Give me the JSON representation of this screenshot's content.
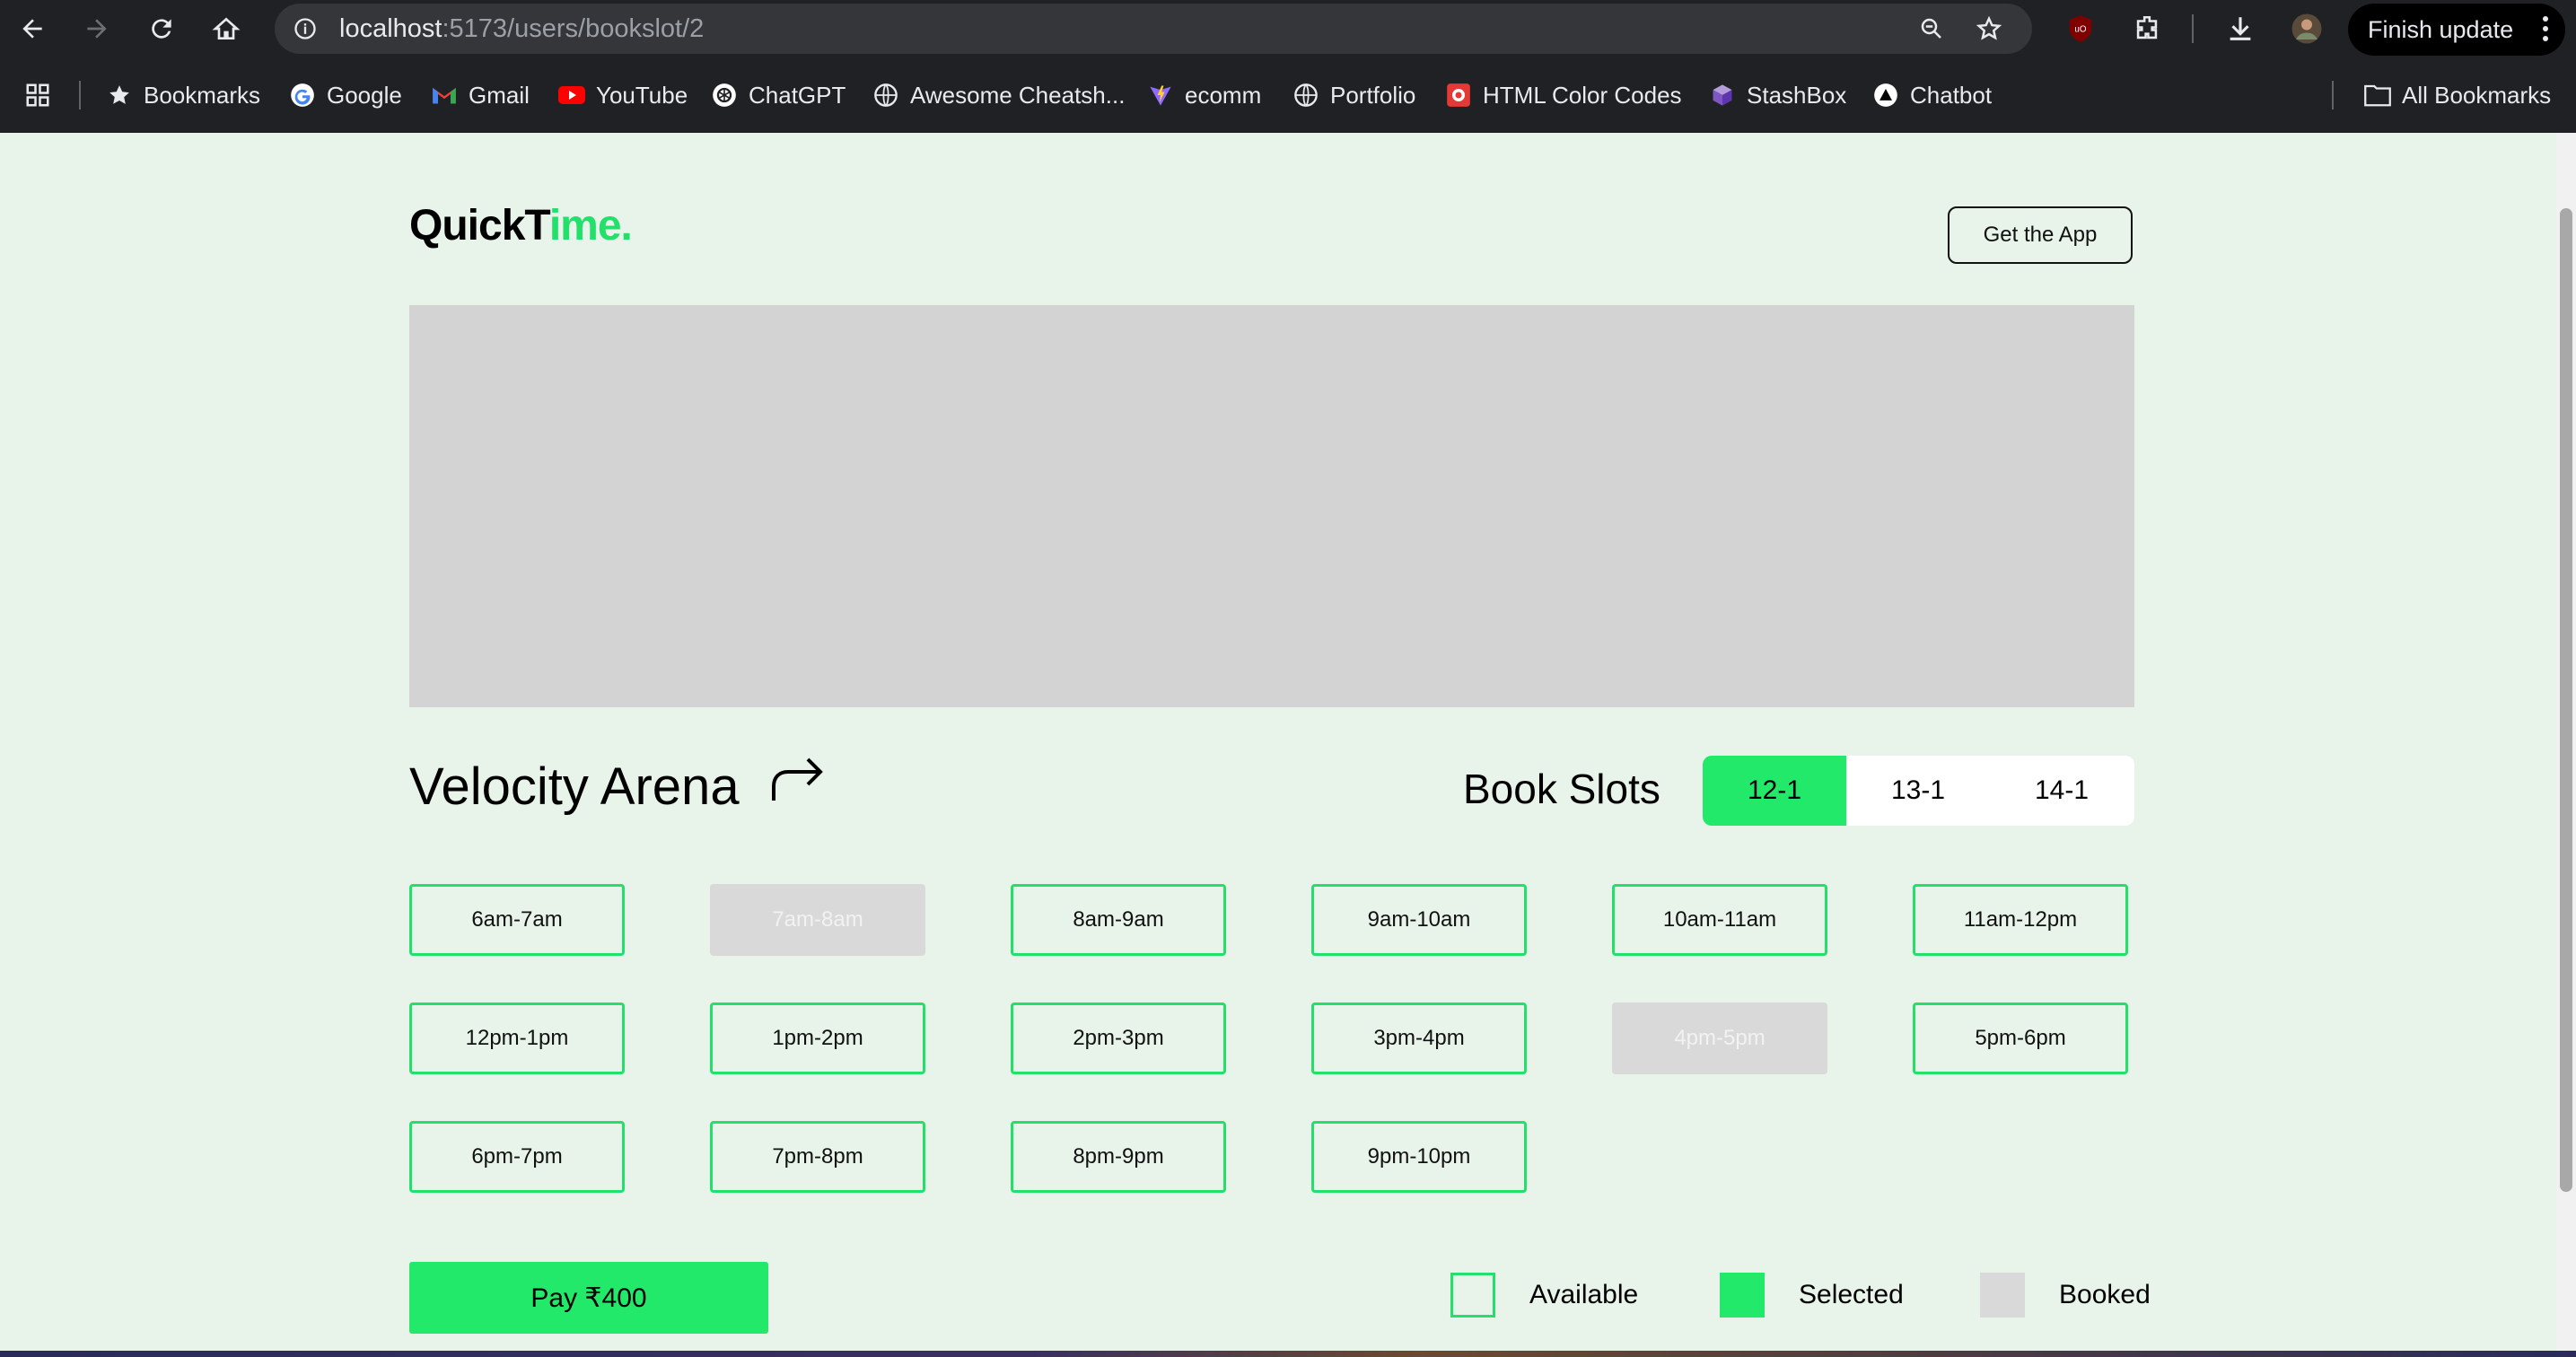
{
  "browser": {
    "url_host": "localhost",
    "url_path": ":5173/users/bookslot/2",
    "finish_update_label": "Finish update",
    "bookmarks": [
      {
        "label": "Bookmarks",
        "icon": "star-icon"
      },
      {
        "label": "Google",
        "icon": "google-icon"
      },
      {
        "label": "Gmail",
        "icon": "gmail-icon"
      },
      {
        "label": "YouTube",
        "icon": "youtube-icon"
      },
      {
        "label": "ChatGPT",
        "icon": "chatgpt-icon"
      },
      {
        "label": "Awesome Cheatsh...",
        "icon": "globe-icon"
      },
      {
        "label": "ecomm",
        "icon": "vite-icon"
      },
      {
        "label": "Portfolio",
        "icon": "globe-icon"
      },
      {
        "label": "HTML Color Codes",
        "icon": "color-codes-icon"
      },
      {
        "label": "StashBox",
        "icon": "stashbox-icon"
      },
      {
        "label": "Chatbot",
        "icon": "triangle-icon"
      }
    ],
    "all_bookmarks_label": "All Bookmarks"
  },
  "header": {
    "logo_main": "QuickT",
    "logo_accent": "ime.",
    "get_app_label": "Get the App"
  },
  "venue": {
    "name": "Velocity Arena"
  },
  "booking": {
    "title": "Book Slots",
    "dates": [
      {
        "label": "12-1",
        "active": true
      },
      {
        "label": "13-1",
        "active": false
      },
      {
        "label": "14-1",
        "active": false
      }
    ],
    "slots": [
      {
        "label": "6am-7am",
        "status": "available"
      },
      {
        "label": "7am-8am",
        "status": "booked"
      },
      {
        "label": "8am-9am",
        "status": "available"
      },
      {
        "label": "9am-10am",
        "status": "available"
      },
      {
        "label": "10am-11am",
        "status": "available"
      },
      {
        "label": "11am-12pm",
        "status": "available"
      },
      {
        "label": "12pm-1pm",
        "status": "available"
      },
      {
        "label": "1pm-2pm",
        "status": "available"
      },
      {
        "label": "2pm-3pm",
        "status": "available"
      },
      {
        "label": "3pm-4pm",
        "status": "available"
      },
      {
        "label": "4pm-5pm",
        "status": "booked"
      },
      {
        "label": "5pm-6pm",
        "status": "available"
      },
      {
        "label": "6pm-7pm",
        "status": "available"
      },
      {
        "label": "7pm-8pm",
        "status": "available"
      },
      {
        "label": "8pm-9pm",
        "status": "available"
      },
      {
        "label": "9pm-10pm",
        "status": "available"
      }
    ],
    "pay_label": "Pay ₹400"
  },
  "legend": {
    "available": "Available",
    "selected": "Selected",
    "booked": "Booked"
  },
  "colors": {
    "accent": "#22e96a",
    "background": "#e8f3ea",
    "booked": "#d9d9d9"
  }
}
